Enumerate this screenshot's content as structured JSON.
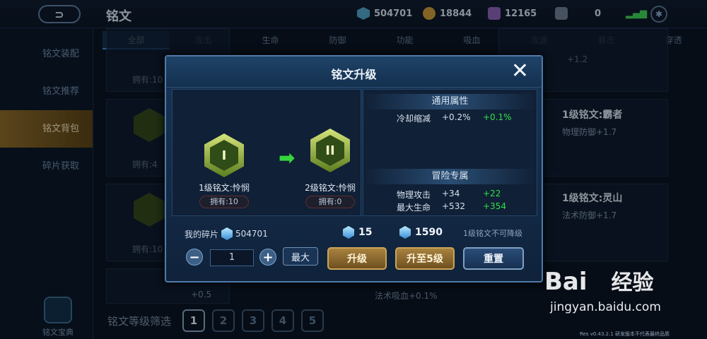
{
  "header": {
    "title": "铭文",
    "back_icon": "back-arrow-icon"
  },
  "resources": [
    {
      "name": "diamond",
      "value": "504701",
      "color": "#4fa3c8"
    },
    {
      "name": "gold",
      "value": "18844",
      "color": "#c79a3a"
    },
    {
      "name": "gem",
      "value": "12165",
      "color": "#8a62b6"
    },
    {
      "name": "card",
      "value": "0",
      "color": "#6d7f94"
    }
  ],
  "tabs": [
    "全部",
    "攻击",
    "生命",
    "防御",
    "功能",
    "吸血",
    "攻速",
    "暴击",
    "穿透"
  ],
  "sidebar": {
    "items": [
      "铭文装配",
      "铭文推荐",
      "铭文背包",
      "碎片获取"
    ],
    "active_index": 2,
    "bottom_label": "铭文宝典"
  },
  "background": {
    "own_labels": [
      "拥有:10",
      "拥有:4",
      "拥有:10"
    ],
    "right_items": [
      {
        "name": "1级铭文:霸者",
        "stat": "物理防御+1.7"
      },
      {
        "name": "1级铭文:灵山",
        "stat": "法术防御+1.7"
      }
    ],
    "fragments": [
      "+1.2",
      "+0.5",
      "法术吸血+0.1%"
    ],
    "filter_label": "铭文等级筛选",
    "levels": [
      "1",
      "2",
      "3",
      "4",
      "5"
    ]
  },
  "modal": {
    "title": "铭文升级",
    "close_icon": "close-x-icon",
    "from_rune": {
      "name": "1级铭文:怜悯",
      "owned": "拥有:10",
      "level": "I"
    },
    "to_rune": {
      "name": "2级铭文:怜悯",
      "owned": "拥有:0",
      "level": "II"
    },
    "general_header": "通用属性",
    "general_attrs": [
      {
        "name": "冷却缩减",
        "value": "+0.2%",
        "delta": "+0.1%"
      }
    ],
    "adventure_header": "冒险专属",
    "adventure_attrs": [
      {
        "name": "物理攻击",
        "value": "+34",
        "delta": "+22"
      },
      {
        "name": "最大生命",
        "value": "+532",
        "delta": "+354"
      }
    ],
    "my_fragments_label": "我的碎片",
    "my_fragments_value": "504701",
    "cost_1": "15",
    "cost_2": "1590",
    "no_downgrade": "1级铭文不可降级",
    "quantity": "1",
    "minus_label": "−",
    "plus_label": "+",
    "max_label": "最大",
    "upgrade_label": "升级",
    "upgrade5_label": "升至5级",
    "reset_label": "重置"
  },
  "watermark": {
    "logo_1": "Bai",
    "logo_2": "经验",
    "url": "jingyan.baidu.com"
  },
  "footnote": "Res v0.43.2.1 研发版本不代表最终品质"
}
